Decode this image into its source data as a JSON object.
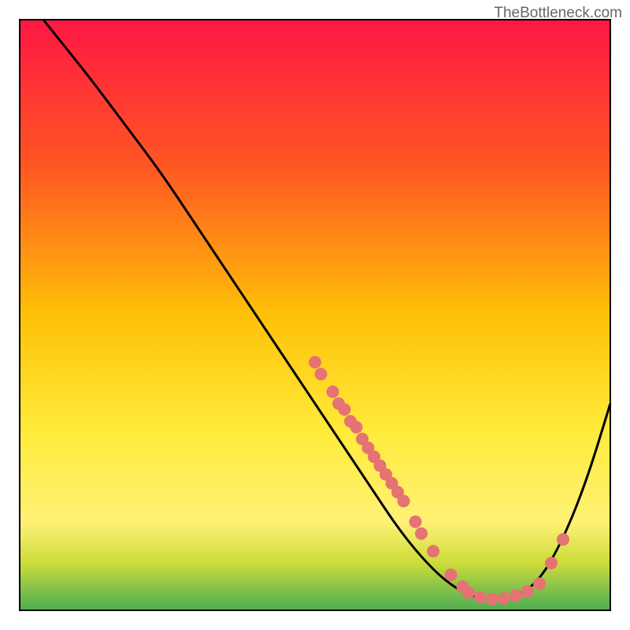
{
  "attribution": "TheBottleneck.com",
  "chart_data": {
    "type": "line",
    "title": "",
    "xlabel": "",
    "ylabel": "",
    "xlim": [
      0,
      100
    ],
    "ylim": [
      0,
      100
    ],
    "curve_points": [
      {
        "x": 4,
        "y": 100
      },
      {
        "x": 8,
        "y": 95
      },
      {
        "x": 12,
        "y": 90
      },
      {
        "x": 18,
        "y": 82
      },
      {
        "x": 24,
        "y": 74
      },
      {
        "x": 30,
        "y": 65
      },
      {
        "x": 36,
        "y": 56
      },
      {
        "x": 42,
        "y": 47
      },
      {
        "x": 48,
        "y": 38
      },
      {
        "x": 52,
        "y": 32
      },
      {
        "x": 56,
        "y": 26
      },
      {
        "x": 60,
        "y": 20
      },
      {
        "x": 64,
        "y": 14
      },
      {
        "x": 68,
        "y": 9
      },
      {
        "x": 72,
        "y": 5
      },
      {
        "x": 76,
        "y": 2.5
      },
      {
        "x": 80,
        "y": 1.8
      },
      {
        "x": 84,
        "y": 2.2
      },
      {
        "x": 88,
        "y": 5
      },
      {
        "x": 92,
        "y": 12
      },
      {
        "x": 96,
        "y": 22
      },
      {
        "x": 100,
        "y": 35
      }
    ],
    "scatter_points": [
      {
        "x": 50,
        "y": 42
      },
      {
        "x": 51,
        "y": 40
      },
      {
        "x": 53,
        "y": 37
      },
      {
        "x": 54,
        "y": 35
      },
      {
        "x": 55,
        "y": 34
      },
      {
        "x": 56,
        "y": 32
      },
      {
        "x": 57,
        "y": 31
      },
      {
        "x": 58,
        "y": 29
      },
      {
        "x": 59,
        "y": 27.5
      },
      {
        "x": 60,
        "y": 26
      },
      {
        "x": 61,
        "y": 24.5
      },
      {
        "x": 62,
        "y": 23
      },
      {
        "x": 63,
        "y": 21.5
      },
      {
        "x": 64,
        "y": 20
      },
      {
        "x": 65,
        "y": 18.5
      },
      {
        "x": 67,
        "y": 15
      },
      {
        "x": 68,
        "y": 13
      },
      {
        "x": 70,
        "y": 10
      },
      {
        "x": 73,
        "y": 6
      },
      {
        "x": 75,
        "y": 4
      },
      {
        "x": 76,
        "y": 3
      },
      {
        "x": 78,
        "y": 2.2
      },
      {
        "x": 80,
        "y": 1.9
      },
      {
        "x": 82,
        "y": 2
      },
      {
        "x": 84,
        "y": 2.5
      },
      {
        "x": 86,
        "y": 3.2
      },
      {
        "x": 88,
        "y": 4.5
      },
      {
        "x": 90,
        "y": 8
      },
      {
        "x": 92,
        "y": 12
      }
    ],
    "gradient_stops": [
      {
        "offset": 0,
        "color": "#ff1744"
      },
      {
        "offset": 25,
        "color": "#ff5722"
      },
      {
        "offset": 50,
        "color": "#ffc107"
      },
      {
        "offset": 70,
        "color": "#ffeb3b"
      },
      {
        "offset": 85,
        "color": "#fff176"
      },
      {
        "offset": 92,
        "color": "#cddc39"
      },
      {
        "offset": 96,
        "color": "#8bc34a"
      },
      {
        "offset": 100,
        "color": "#4caf50"
      }
    ],
    "point_color": "#e57373",
    "point_radius": 8,
    "plot_margin": 25
  }
}
